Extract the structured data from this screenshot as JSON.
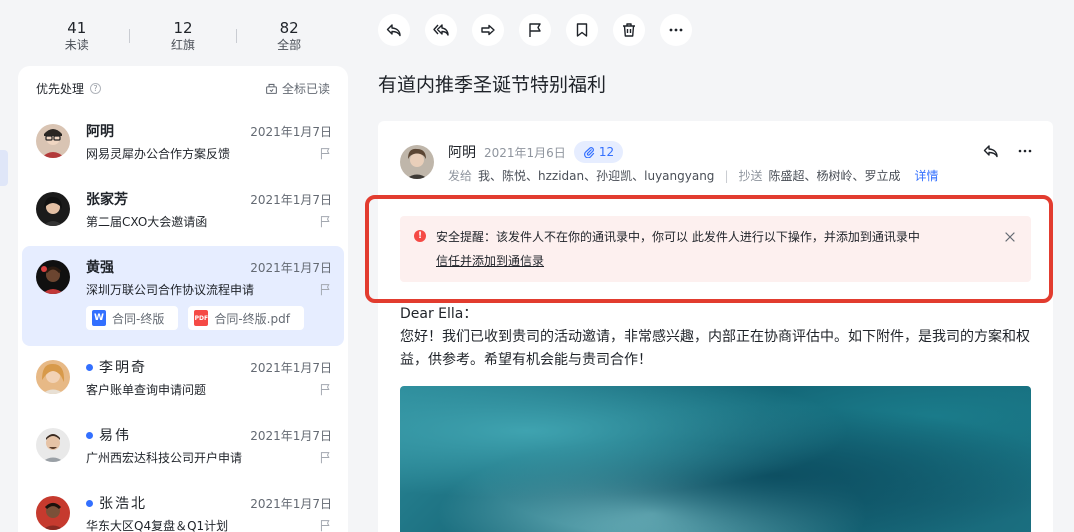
{
  "stats": [
    {
      "count": "41",
      "label": "未读"
    },
    {
      "count": "12",
      "label": "红旗"
    },
    {
      "count": "82",
      "label": "全部"
    }
  ],
  "list": {
    "section_title": "优先处理",
    "help": "?",
    "mark_all_read": "全标已读",
    "items": [
      {
        "sender": "阿明",
        "date": "2021年1月7日",
        "subject": "网易灵犀办公合作方案反馈",
        "unread": false
      },
      {
        "sender": "张家芳",
        "date": "2021年1月7日",
        "subject": "第二届CXO大会邀请函",
        "unread": false
      },
      {
        "sender": "黄强",
        "date": "2021年1月7日",
        "subject": "深圳万联公司合作协议流程申请",
        "unread": false,
        "attachments": [
          {
            "name": "合同-终版",
            "type": "W",
            "color": "#3370ff"
          },
          {
            "name": "合同-终版.pdf",
            "type": "PDF",
            "color": "#f54a45"
          }
        ]
      },
      {
        "sender": "李明奇",
        "date": "2021年1月7日",
        "subject": "客户账单查询申请问题",
        "unread": true
      },
      {
        "sender": "易伟",
        "date": "2021年1月7日",
        "subject": "广州西宏达科技公司开户申请",
        "unread": true
      },
      {
        "sender": "张浩北",
        "date": "2021年1月7日",
        "subject": "华东大区Q4复盘＆Q1计划",
        "unread": true
      }
    ]
  },
  "toolbar": [
    "reply-icon",
    "reply-all-icon",
    "forward-icon",
    "flag-icon",
    "bookmark-icon",
    "delete-icon",
    "more-icon"
  ],
  "mail": {
    "title": "有道内推季圣诞节特别福利",
    "sender": "阿明",
    "date": "2021年1月6日",
    "attachment_count": "12",
    "to_label": "发给",
    "to": "我、陈悦、hzzidan、孙迎凯、luyangyang",
    "cc_label": "抄送",
    "cc": "陈盛超、杨树岭、罗立成",
    "details": "详情",
    "alert_text": "安全提醒：该发件人不在你的通讯录中，你可以  此发件人进行以下操作，并添加到通讯录中",
    "alert_link": "信任并添加到通信录",
    "greeting": "Dear Ella：",
    "body": "您好！我们已收到贵司的活动邀请，非常感兴趣，内部正在协商评估中。如下附件，是我司的方案和权益，供参考。希望有机会能与贵司合作！"
  },
  "colors": {
    "accent": "#3370ff",
    "alert": "#f54a45",
    "highlight": "#e23c2f"
  }
}
